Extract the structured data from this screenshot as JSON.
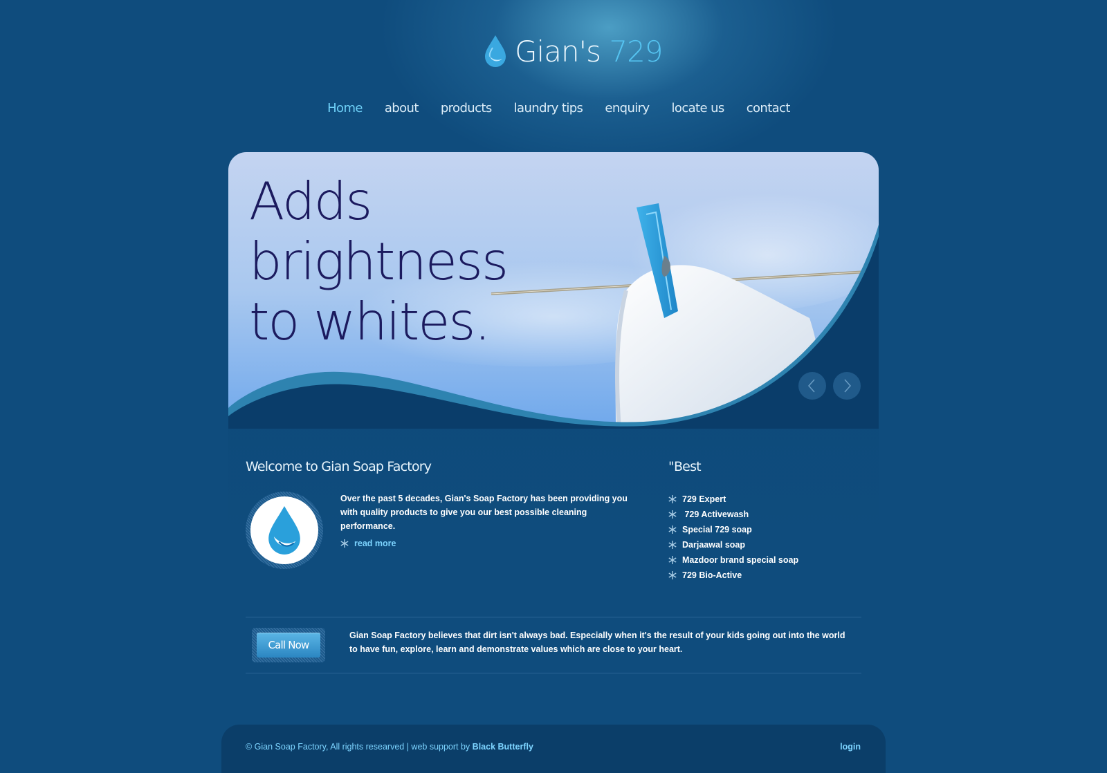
{
  "brand": {
    "name_part1": "Gian's",
    "name_part2": "729"
  },
  "nav": {
    "items": [
      {
        "label": "Home",
        "active": true
      },
      {
        "label": "about"
      },
      {
        "label": "products"
      },
      {
        "label": "laundry tips"
      },
      {
        "label": "enquiry"
      },
      {
        "label": "locate us"
      },
      {
        "label": "contact"
      }
    ]
  },
  "hero": {
    "headline_lines": [
      "Adds",
      "brightness",
      "to whites."
    ]
  },
  "welcome": {
    "title": "Welcome to Gian Soap Factory",
    "text": "Over the past 5 decades, Gian's Soap Factory has been providing you with quality products to give you our best possible cleaning performance.",
    "read_more": "read more"
  },
  "best": {
    "title": "\"Best",
    "items": [
      "729 Expert",
      " 729 Activewash",
      "Special 729 soap",
      "Darjaawal soap",
      "Mazdoor brand special soap",
      "729 Bio-Active"
    ]
  },
  "call": {
    "button": "Call Now",
    "text": "Gian Soap Factory believes that dirt isn't always bad. Especially when it's the result of your kids going out into the world to have fun, explore, learn and demonstrate values which are close to your heart."
  },
  "footer": {
    "copyright": "© Gian Soap Factory, All rights researved | web support by",
    "credit": "Black Butterfly",
    "login": "login"
  },
  "colors": {
    "background": "#0f4c7d",
    "accent": "#55c3f0",
    "link": "#7dd4ff",
    "headline": "#1b1a5e",
    "button": "#3a9ad6"
  },
  "icons": [
    "water-drop-icon",
    "arrow-left-icon",
    "arrow-right-icon",
    "snowflake-bullet-icon"
  ]
}
